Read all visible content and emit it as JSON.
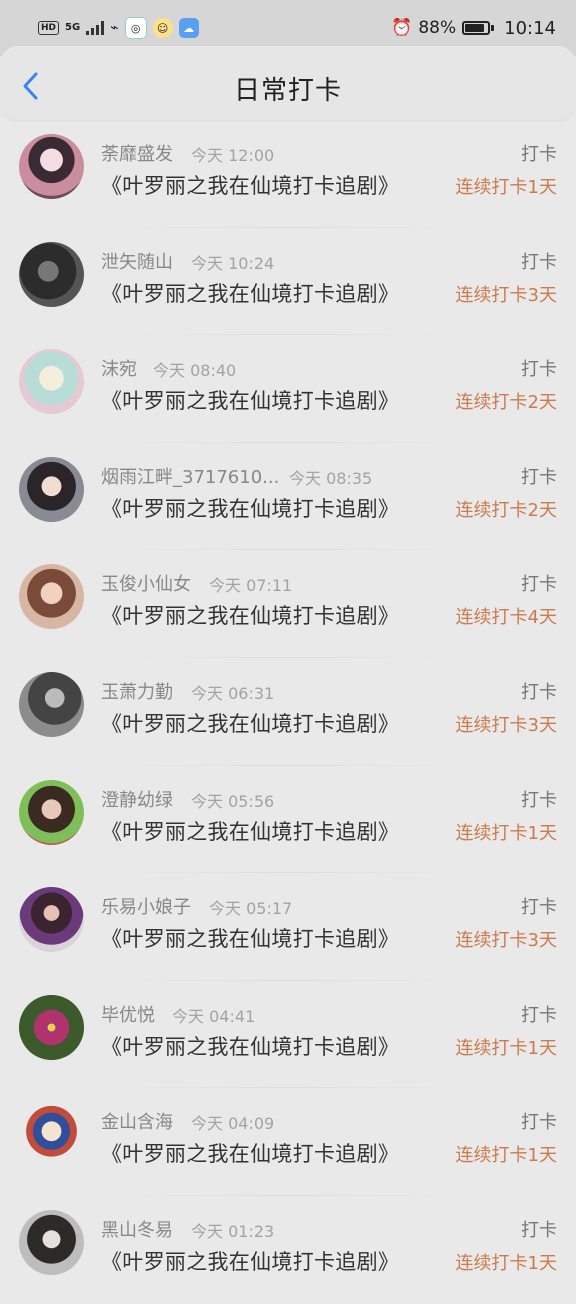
{
  "status_bar": {
    "hd_label": "HD",
    "network_label": "5G",
    "battery_percent": "88%",
    "time": "10:14"
  },
  "header": {
    "title": "日常打卡"
  },
  "entries": [
    {
      "name": "荼靡盛发",
      "time": "今天 12:00",
      "title": "《叶罗丽之我在仙境打卡追剧》",
      "tag": "打卡",
      "streak": "连续打卡1天"
    },
    {
      "name": "泄矢随山",
      "time": "今天 10:24",
      "title": "《叶罗丽之我在仙境打卡追剧》",
      "tag": "打卡",
      "streak": "连续打卡3天"
    },
    {
      "name": "沫宛",
      "time": "今天 08:40",
      "title": "《叶罗丽之我在仙境打卡追剧》",
      "tag": "打卡",
      "streak": "连续打卡2天"
    },
    {
      "name": "烟雨江畔_3717610...",
      "time": "今天 08:35",
      "title": "《叶罗丽之我在仙境打卡追剧》",
      "tag": "打卡",
      "streak": "连续打卡2天"
    },
    {
      "name": "玉俊小仙女",
      "time": "今天 07:11",
      "title": "《叶罗丽之我在仙境打卡追剧》",
      "tag": "打卡",
      "streak": "连续打卡4天"
    },
    {
      "name": "玉萧力勤",
      "time": "今天 06:31",
      "title": "《叶罗丽之我在仙境打卡追剧》",
      "tag": "打卡",
      "streak": "连续打卡3天"
    },
    {
      "name": "澄静幼绿",
      "time": "今天 05:56",
      "title": "《叶罗丽之我在仙境打卡追剧》",
      "tag": "打卡",
      "streak": "连续打卡1天"
    },
    {
      "name": "乐易小娘子",
      "time": "今天 05:17",
      "title": "《叶罗丽之我在仙境打卡追剧》",
      "tag": "打卡",
      "streak": "连续打卡3天"
    },
    {
      "name": "毕优悦",
      "time": "今天 04:41",
      "title": "《叶罗丽之我在仙境打卡追剧》",
      "tag": "打卡",
      "streak": "连续打卡1天"
    },
    {
      "name": "金山含海",
      "time": "今天 04:09",
      "title": "《叶罗丽之我在仙境打卡追剧》",
      "tag": "打卡",
      "streak": "连续打卡1天"
    },
    {
      "name": "黑山冬易",
      "time": "今天 01:23",
      "title": "《叶罗丽之我在仙境打卡追剧》",
      "tag": "打卡",
      "streak": "连续打卡1天"
    }
  ],
  "colors": {
    "accent_blue": "#3b82f6",
    "streak": "#cd7a4d"
  }
}
